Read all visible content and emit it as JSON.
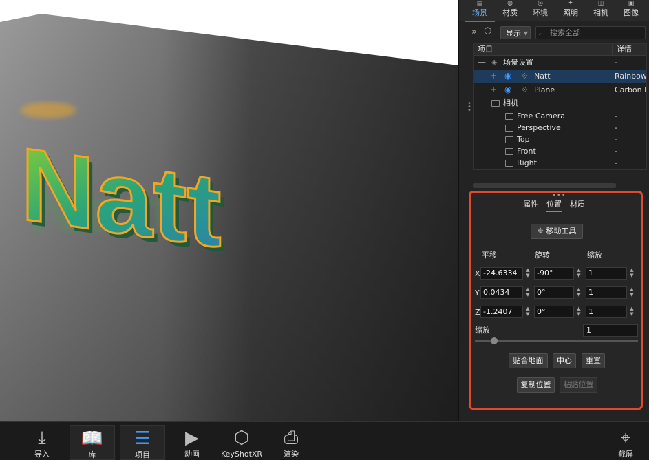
{
  "viewport": {
    "model_text": "Natt",
    "colors": {
      "floor_dark": "#3a3a3a",
      "floor_light": "#8c8c8c",
      "wall": "#ffffff",
      "text_fill": "#2f9a6a",
      "text_edge": "#f3a623"
    }
  },
  "panel": {
    "tabs": [
      {
        "label": "场景",
        "icon": "scene-icon",
        "active": true
      },
      {
        "label": "材质",
        "icon": "material-icon"
      },
      {
        "label": "环境",
        "icon": "environment-icon"
      },
      {
        "label": "照明",
        "icon": "lighting-icon"
      },
      {
        "label": "相机",
        "icon": "camera-icon"
      },
      {
        "label": "图像",
        "icon": "image-icon"
      }
    ],
    "toolbar": {
      "chevron": "»",
      "display_dropdown": "显示",
      "search_placeholder": "搜索全部"
    },
    "tree": {
      "col_item": "项目",
      "col_detail": "详情",
      "rows": [
        {
          "toggle": "—",
          "name": "场景设置",
          "detail": "-"
        },
        {
          "toggle": "+",
          "name": "Natt",
          "detail": "Rainbow",
          "selected": true
        },
        {
          "toggle": "+",
          "name": "Plane",
          "detail": "Carbon F"
        },
        {
          "toggle": "—",
          "name": "相机",
          "detail": ""
        },
        {
          "name": "Free Camera",
          "detail": "-"
        },
        {
          "name": "Perspective",
          "detail": "-"
        },
        {
          "name": "Top",
          "detail": "-"
        },
        {
          "name": "Front",
          "detail": "-"
        },
        {
          "name": "Right",
          "detail": "-"
        }
      ]
    },
    "properties": {
      "tabs": [
        "属性",
        "位置",
        "材质"
      ],
      "active_tab": "位置",
      "move_tool_label": "移动工具",
      "col_translate": "平移",
      "col_rotate": "旋转",
      "col_scale": "缩放",
      "axes": [
        {
          "axis": "X",
          "translate": "-24.6334",
          "rotate": "-90°",
          "scale": "1"
        },
        {
          "axis": "Y",
          "translate": "0.0434",
          "rotate": "0°",
          "scale": "1"
        },
        {
          "axis": "Z",
          "translate": "-1.2407",
          "rotate": "0°",
          "scale": "1"
        }
      ],
      "uniform_scale_label": "缩放",
      "uniform_scale_value": "1",
      "uniform_scale_slider_fraction": 0.12,
      "buttons": {
        "snap_ground": "贴合地面",
        "center": "中心",
        "reset": "重置",
        "copy_position": "复制位置",
        "paste_position": "粘贴位置"
      },
      "highlight_color": "#e04a2a"
    }
  },
  "bottom_bar": {
    "items": [
      {
        "label": "导入",
        "icon": "import-icon"
      },
      {
        "label": "库",
        "icon": "library-icon",
        "active": true
      },
      {
        "label": "项目",
        "icon": "project-icon",
        "active": true
      },
      {
        "label": "动画",
        "icon": "animation-icon"
      },
      {
        "label": "KeyShotXR",
        "icon": "keyshotxr-icon"
      },
      {
        "label": "渲染",
        "icon": "render-icon"
      },
      {
        "label": "截屏",
        "icon": "screenshot-icon"
      }
    ]
  }
}
